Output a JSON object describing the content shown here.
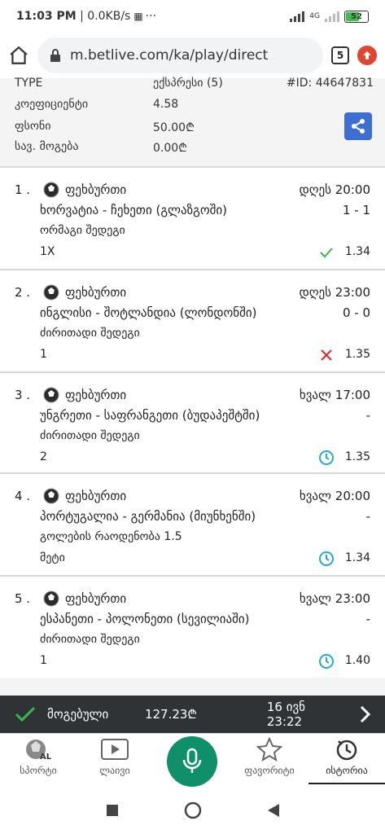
{
  "status_bar": {
    "time": "11:03 PM",
    "speed": "0.0KB/s",
    "network": "4G",
    "battery": "52"
  },
  "browser": {
    "url": "m.betlive.com/ka/play/direct",
    "tabs_count": "5"
  },
  "summary": {
    "type_label": "TYPE",
    "type_value": "ექსპრესი (5)",
    "id": "#ID: 44647831",
    "odds_label": "კოეფიციენტი",
    "odds_value": "4.58",
    "stake_label": "ფსონი",
    "stake_value": "50.00₾",
    "payout_label": "სავ. მოგება",
    "payout_value": "0.00₾"
  },
  "bets": [
    {
      "num": "1 .",
      "sport": "ფეხბურთი",
      "datetime": "დღეს 20:00",
      "teams": "ხორვატია - ჩეხეთი (გლაზგოში)",
      "score": "1 - 1",
      "market": "ორმაგი შედეგი",
      "pick": "1X",
      "status": "won",
      "odd": "1.34"
    },
    {
      "num": "2 .",
      "sport": "ფეხბურთი",
      "datetime": "დღეს 23:00",
      "teams": "ინგლისი - შოტლანდია (ლონდონში)",
      "score": "0 - 0",
      "market": "ძირითადი შედეგი",
      "pick": "1",
      "status": "lost",
      "odd": "1.35"
    },
    {
      "num": "3 .",
      "sport": "ფეხბურთი",
      "datetime": "ხვალ 17:00",
      "teams": "უნგრეთი - საფრანგეთი (ბუდაპეშტში)",
      "score": "-",
      "market": "ძირითადი შედეგი",
      "pick": "2",
      "status": "pending",
      "odd": "1.35"
    },
    {
      "num": "4 .",
      "sport": "ფეხბურთი",
      "datetime": "ხვალ 20:00",
      "teams": "პორტუგალია - გერმანია (მიუნხენში)",
      "score": "-",
      "market": "გოლების რაოდენობა 1.5",
      "pick": "მეტი",
      "status": "pending",
      "odd": "1.34"
    },
    {
      "num": "5 .",
      "sport": "ფეხბურთი",
      "datetime": "ხვალ 23:00",
      "teams": "ესპანეთი - პოლონეთი (სევილიაში)",
      "score": "-",
      "market": "ძირითადი შედეგი",
      "pick": "1",
      "status": "pending",
      "odd": "1.40"
    }
  ],
  "won_bar": {
    "label": "მოგებული",
    "amount": "127.23₾",
    "date": "16 ივნ 23:22"
  },
  "bottom_nav": [
    {
      "label": "სპორტი",
      "icon": "all-sports-icon",
      "badge": "ALL"
    },
    {
      "label": "ლაივი",
      "icon": "play-icon"
    },
    {
      "label": "",
      "icon": "mic-icon"
    },
    {
      "label": "ფავორიტი",
      "icon": "star-icon"
    },
    {
      "label": "ისტორია",
      "icon": "history-icon"
    }
  ],
  "colors": {
    "won": "#3bb54a",
    "lost": "#e0302b",
    "pending": "#2aa6d6",
    "accent_green": "#0f8f6a",
    "share_blue": "#3c6fd1"
  }
}
